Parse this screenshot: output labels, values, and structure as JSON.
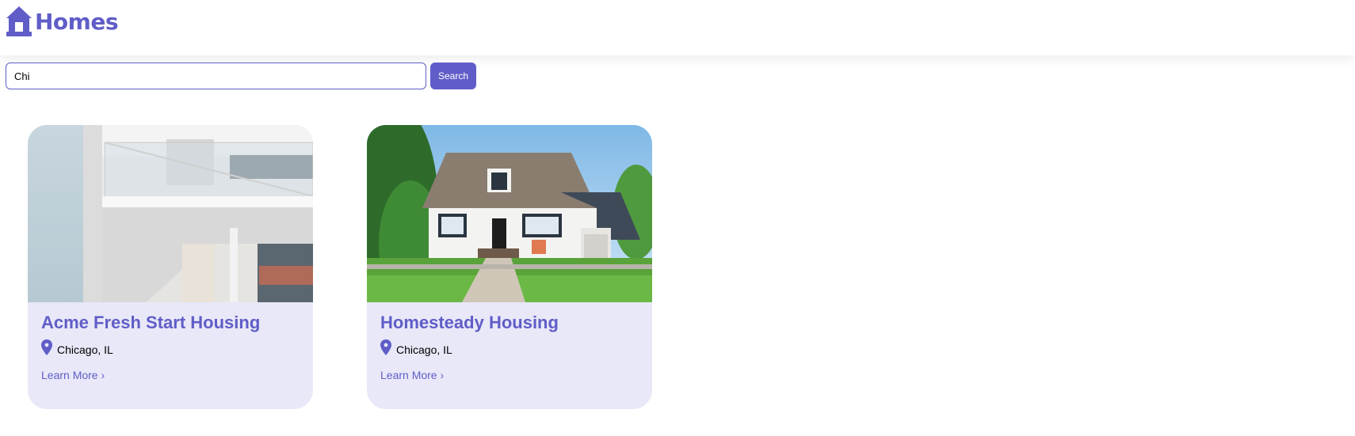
{
  "header": {
    "logo_icon": "house-icon",
    "logo_text": "Homes"
  },
  "search": {
    "value": "Chi",
    "button_label": "Search"
  },
  "listings": [
    {
      "title": "Acme Fresh Start Housing",
      "location": "Chicago, IL",
      "link_label": "Learn More ›",
      "image": "modern white apartment building with glass balconies"
    },
    {
      "title": "Homesteady Housing",
      "location": "Chicago, IL",
      "link_label": "Learn More ›",
      "image": "white suburban house with gray roof and green lawn"
    }
  ],
  "colors": {
    "accent": "#605dc8",
    "card_bg": "#e8e8f8"
  }
}
